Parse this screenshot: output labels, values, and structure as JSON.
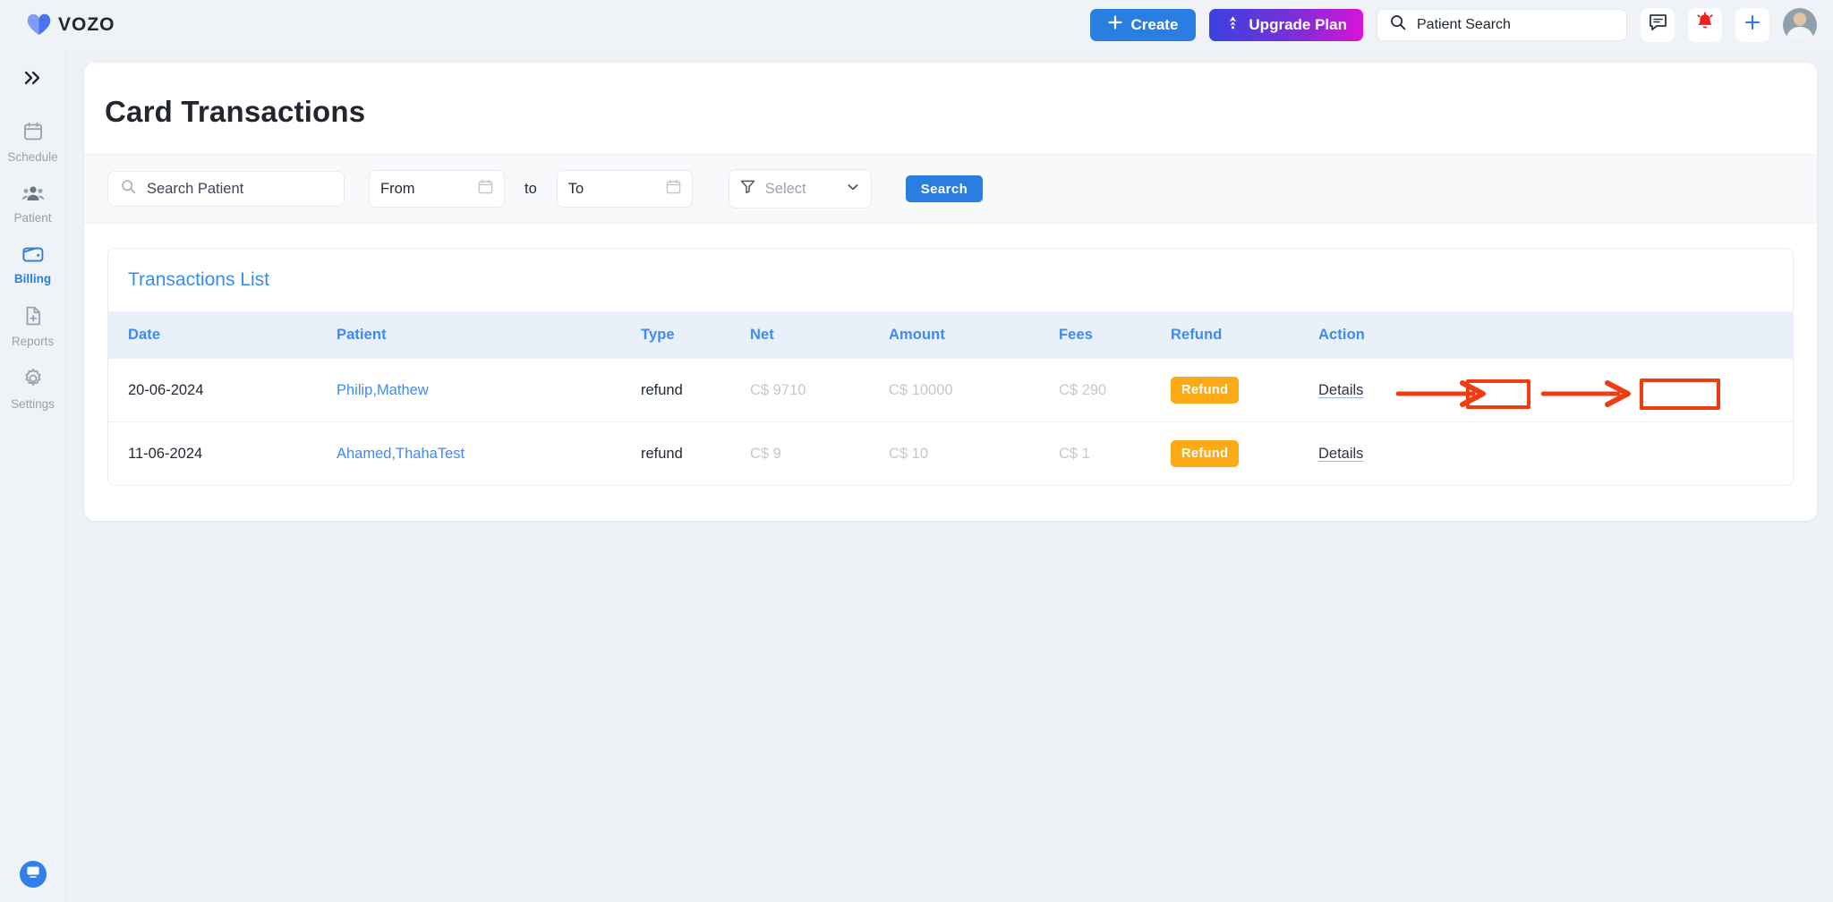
{
  "topbar": {
    "logo_text": "VOZO",
    "logo_icon": "heart-icon",
    "create_label": "Create",
    "create_icon": "plus-icon",
    "upgrade_label": "Upgrade Plan",
    "upgrade_icon": "rocket-icon",
    "search_placeholder": "Patient Search",
    "search_value": "",
    "search_icon": "search-icon",
    "chat_icon": "chat-icon",
    "bell_icon": "bell-icon",
    "plus_icon": "plus-icon",
    "avatar_icon": "avatar"
  },
  "sidebar": {
    "expand_icon": "chevron-double-right-icon",
    "items": [
      {
        "label": "Schedule",
        "icon": "calendar-icon",
        "active": false
      },
      {
        "label": "Patient",
        "icon": "people-icon",
        "active": false
      },
      {
        "label": "Billing",
        "icon": "wallet-icon",
        "active": true
      },
      {
        "label": "Reports",
        "icon": "document-plus-icon",
        "active": false
      },
      {
        "label": "Settings",
        "icon": "gear-icon",
        "active": false
      }
    ],
    "bottom_icon": "monitor-icon"
  },
  "page": {
    "title": "Card Transactions"
  },
  "filters": {
    "search_placeholder": "Search Patient",
    "search_value": "",
    "search_icon": "search-icon",
    "from_label": "From",
    "from_value": "",
    "to_separator": "to",
    "to_label": "To",
    "to_value": "",
    "calendar_icon": "calendar-icon",
    "filter_icon": "funnel-icon",
    "select_label": "Select",
    "select_chevron": "chevron-down-icon",
    "search_button": "Search"
  },
  "table": {
    "title": "Transactions List",
    "columns": [
      "Date",
      "Patient",
      "Type",
      "Net",
      "Amount",
      "Fees",
      "Refund",
      "Action"
    ],
    "rows": [
      {
        "date": "20-06-2024",
        "patient": "Philip,Mathew",
        "type": "refund",
        "net": "C$ 9710",
        "amount": "C$ 10000",
        "fees": "C$ 290",
        "refund": "Refund",
        "action": "Details",
        "highlighted": true
      },
      {
        "date": "11-06-2024",
        "patient": "Ahamed,ThahaTest",
        "type": "refund",
        "net": "C$ 9",
        "amount": "C$ 10",
        "fees": "C$ 1",
        "refund": "Refund",
        "action": "Details",
        "highlighted": false
      }
    ]
  },
  "annotations": {
    "arrow_color": "#ee3d11",
    "box_color": "#ee3d11",
    "targets": [
      "refund-badge",
      "details-link"
    ]
  },
  "colors": {
    "accent_blue": "#2a7de1",
    "link_blue": "#3d8bf2",
    "badge_amber": "#fcab16",
    "annotation_red": "#ee3d11"
  }
}
